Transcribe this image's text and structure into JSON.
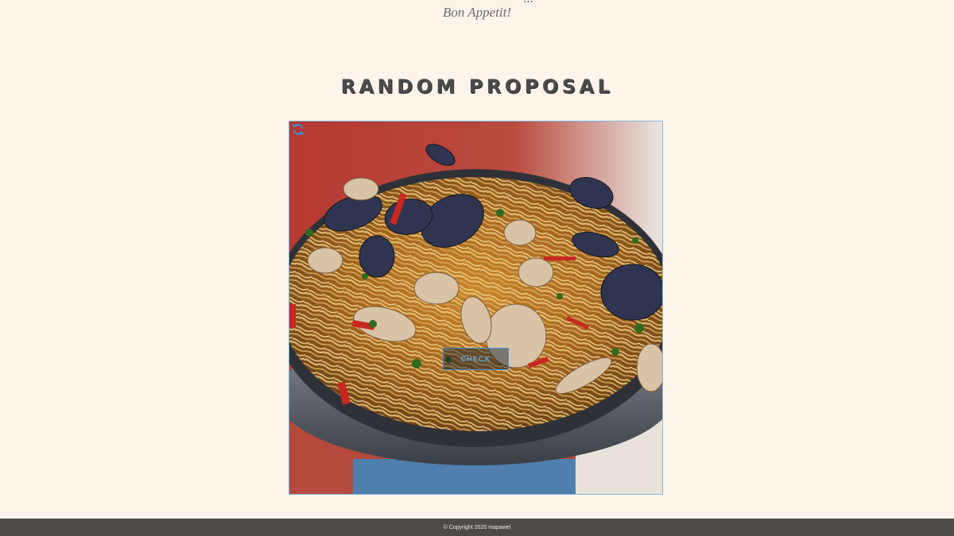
{
  "intro": {
    "partial_line": "...",
    "signoff": "Bon Appetit!"
  },
  "random_proposal": {
    "title": "RANDOM PROPOSAL",
    "photo_subject": "spaghetti with clams",
    "refresh_icon": "refresh-icon",
    "check_label": "CHECK"
  },
  "colors": {
    "background": "#fdf5ec",
    "title": "#4b4b4b",
    "title_underline": "#a9d4ee",
    "accent": "#3f8fd0",
    "footer_bg": "#4d4a48"
  },
  "footer": {
    "copyright": "© Copyright 2020 mapawel"
  }
}
